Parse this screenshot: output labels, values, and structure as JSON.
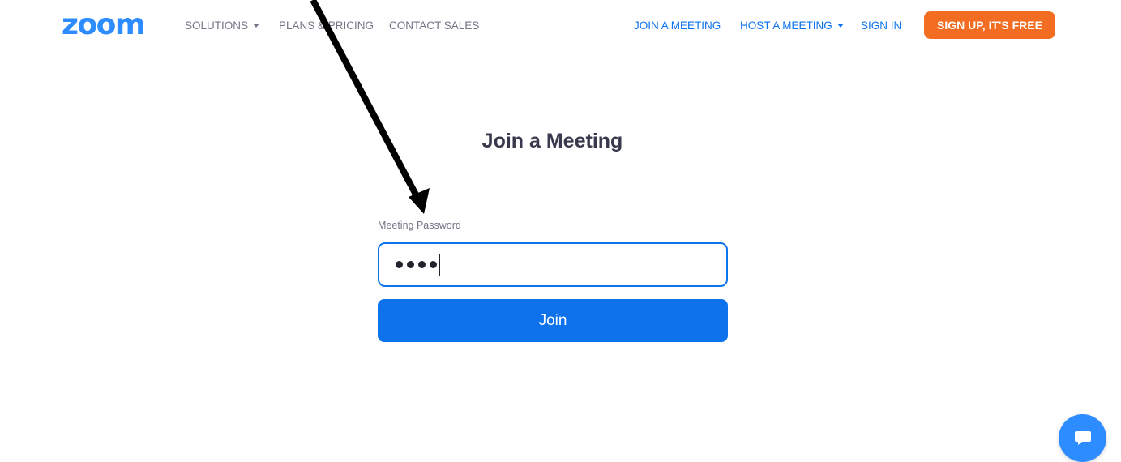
{
  "header": {
    "logo_text": "zoom",
    "nav_left": [
      {
        "label": "SOLUTIONS",
        "has_dropdown": true
      },
      {
        "label": "PLANS & PRICING",
        "has_dropdown": false
      },
      {
        "label": "CONTACT SALES",
        "has_dropdown": false
      }
    ],
    "nav_right": [
      {
        "label": "JOIN A MEETING",
        "has_dropdown": false
      },
      {
        "label": "HOST A MEETING",
        "has_dropdown": true
      },
      {
        "label": "SIGN IN",
        "has_dropdown": false
      }
    ],
    "signup_label": "SIGN UP, IT'S FREE"
  },
  "main": {
    "title": "Join a Meeting",
    "password_label": "Meeting Password",
    "password_masked_length": 4,
    "join_label": "Join"
  },
  "colors": {
    "brand_blue": "#2d8cff",
    "link_blue": "#0e72ed",
    "signup_orange": "#f26d21",
    "nav_gray": "#747487",
    "title_text": "#39394d"
  },
  "icons": {
    "chat": "chat-bubble-icon",
    "dropdown": "caret-down-icon",
    "annotation": "arrow-annotation"
  }
}
